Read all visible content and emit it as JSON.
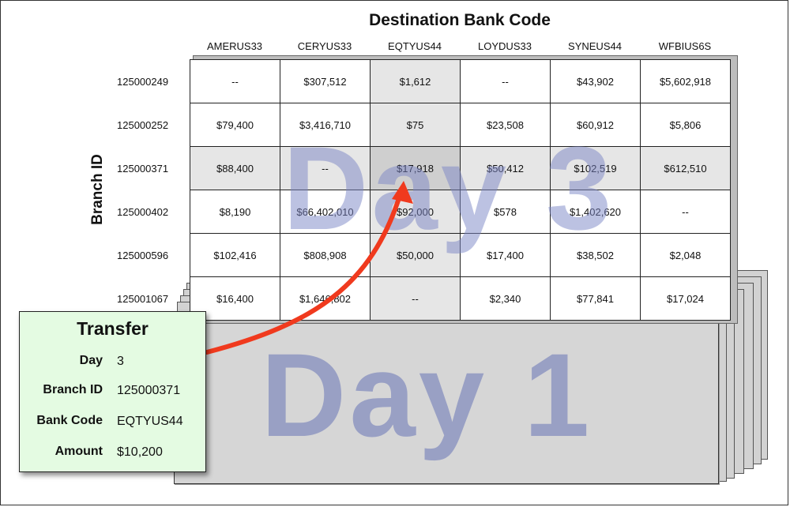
{
  "diagram": {
    "destination_title": "Destination Bank Code",
    "branch_title": "Branch ID",
    "day3_label": "Day 3",
    "day1_label": "Day 1",
    "bank_codes": [
      "AMERUS33",
      "CERYUS33",
      "EQTYUS44",
      "LOYDUS33",
      "SYNEUS44",
      "WFBIUS6S"
    ],
    "branch_ids": [
      "125000249",
      "125000252",
      "125000371",
      "125000402",
      "125000596",
      "125001067"
    ],
    "cells": [
      [
        "--",
        "$307,512",
        "$1,612",
        "--",
        "$43,902",
        "$5,602,918"
      ],
      [
        "$79,400",
        "$3,416,710",
        "$75",
        "$23,508",
        "$60,912",
        "$5,806"
      ],
      [
        "$88,400",
        "--",
        "$17,918",
        "$50,412",
        "$102,519",
        "$612,510"
      ],
      [
        "$8,190",
        "$66,402,010",
        "$92,000",
        "$578",
        "$1,402,620",
        "--"
      ],
      [
        "$102,416",
        "$808,908",
        "$50,000",
        "$17,400",
        "$38,502",
        "$2,048"
      ],
      [
        "$16,400",
        "$1,646,802",
        "--",
        "$2,340",
        "$77,841",
        "$17,024"
      ]
    ],
    "highlight": {
      "row_branch": "125000371",
      "col_bank": "EQTYUS44"
    },
    "colors": {
      "grid_highlight": "#e6e6e6",
      "card_background": "#e4fbe2",
      "arrow": "#f03a1e",
      "watermark": "#7c86c6"
    }
  },
  "transfer": {
    "title": "Transfer",
    "fields": [
      {
        "label": "Day",
        "value": "3"
      },
      {
        "label": "Branch ID",
        "value": "125000371"
      },
      {
        "label": "Bank Code",
        "value": "EQTYUS44"
      },
      {
        "label": "Amount",
        "value": "$10,200"
      }
    ]
  }
}
